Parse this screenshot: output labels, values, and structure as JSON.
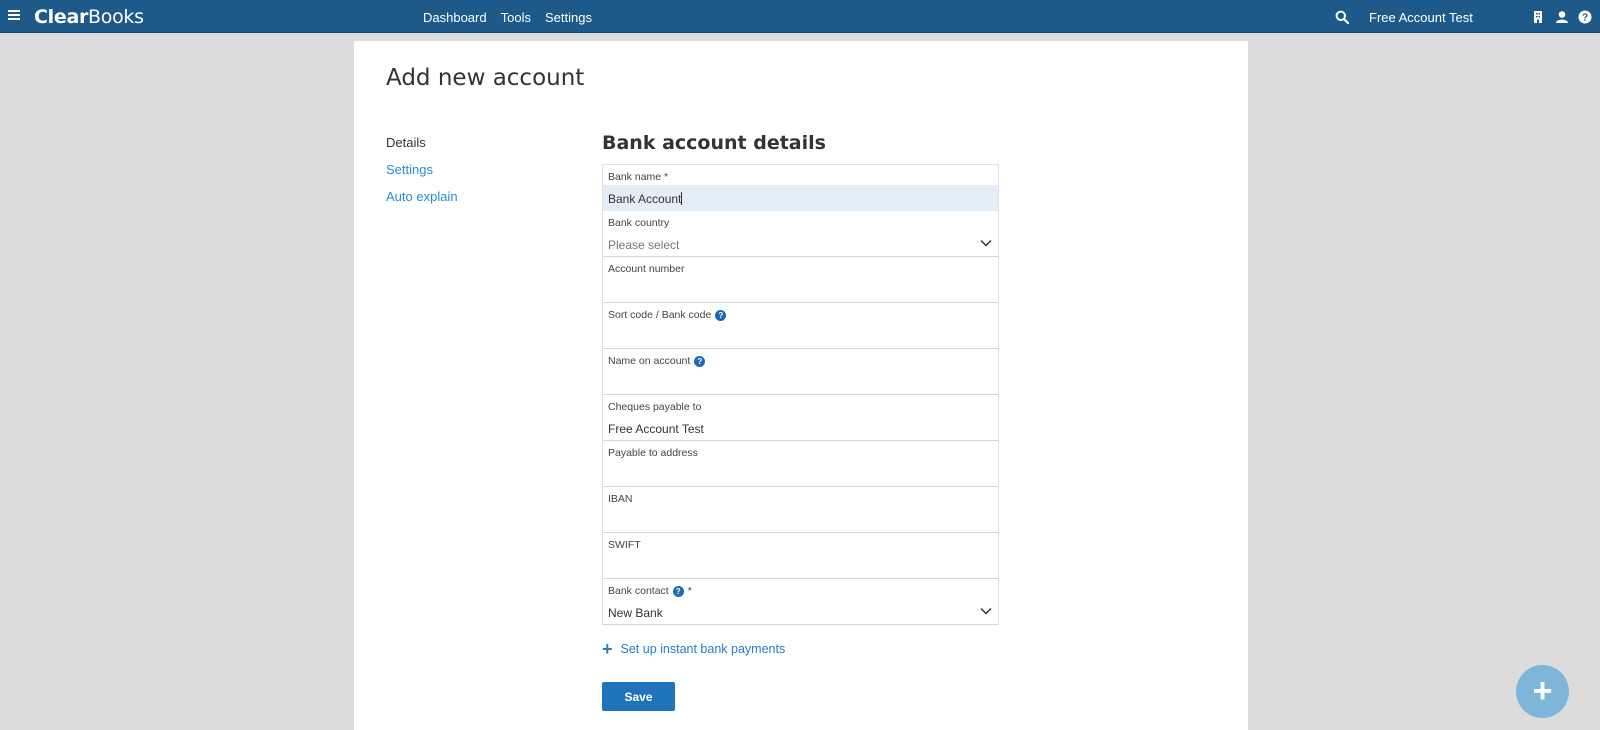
{
  "topbar": {
    "brand_bold": "Clear",
    "brand_light": "Books",
    "nav": [
      "Dashboard",
      "Tools",
      "Settings"
    ],
    "account_name": "Free Account Test",
    "icons": [
      "menu-icon",
      "search-icon",
      "building-icon",
      "user-icon",
      "help-icon"
    ]
  },
  "page": {
    "title": "Add new account",
    "section_title": "Bank account details"
  },
  "sidenav": {
    "items": [
      {
        "label": "Details",
        "active": true
      },
      {
        "label": "Settings",
        "active": false
      },
      {
        "label": "Auto explain",
        "active": false
      }
    ]
  },
  "form": {
    "fields": [
      {
        "label": "Bank name *",
        "value": "Bank Account",
        "type": "text",
        "focused": true
      },
      {
        "label": "Bank country",
        "value": "Please select",
        "type": "select",
        "placeholder": true
      },
      {
        "label": "Account number",
        "value": "",
        "type": "text"
      },
      {
        "label": "Sort code / Bank code",
        "value": "",
        "type": "text",
        "help": true
      },
      {
        "label": "Name on account",
        "value": "",
        "type": "text",
        "help": true
      },
      {
        "label": "Cheques payable to",
        "value": "Free Account Test",
        "type": "text"
      },
      {
        "label": "Payable to address",
        "value": "",
        "type": "text"
      },
      {
        "label": "IBAN",
        "value": "",
        "type": "text"
      },
      {
        "label": "SWIFT",
        "value": "",
        "type": "text"
      },
      {
        "label": "Bank contact",
        "label_suffix": "*",
        "value": "New Bank",
        "type": "select",
        "help": true
      }
    ]
  },
  "actions": {
    "instant_payments_label": "Set up instant bank payments",
    "save_label": "Save",
    "fab_label": "+"
  },
  "colors": {
    "topbar": "#1d5a8a",
    "link": "#2b8bd1",
    "primary_button": "#1f73ba",
    "fab": "#7eb6da"
  }
}
